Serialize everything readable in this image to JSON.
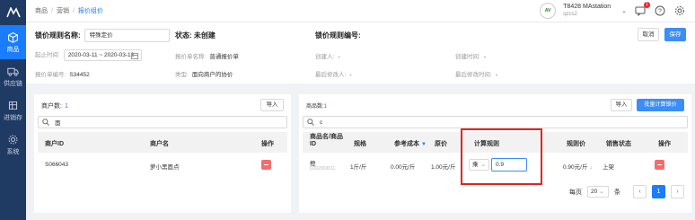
{
  "sidebar": {
    "items": [
      {
        "label": "商品",
        "icon": "box-icon",
        "active": true
      },
      {
        "label": "供应链",
        "icon": "truck-icon",
        "active": false
      },
      {
        "label": "进销存",
        "icon": "inventory-icon",
        "active": false
      },
      {
        "label": "系统",
        "icon": "gear-icon",
        "active": false
      }
    ]
  },
  "breadcrumb": [
    "商品",
    "营销",
    "报价组价"
  ],
  "topbar": {
    "store_logo": "AV",
    "store_name": "T8428 MAstation",
    "store_code": "qzcs2",
    "notification_count": "1"
  },
  "header": {
    "name_label": "锁价规则名称:",
    "name_value": "特殊定价",
    "status_label": "状态:",
    "status_value": "未创建",
    "code_label": "锁价规则编号:",
    "cancel_label": "取消",
    "save_label": "保存",
    "start_label": "起止时间",
    "date_range": "2020-03-11 ~ 2020-03-13",
    "quote_name_label": "报价单名称:",
    "quote_name_value": "普通报价单",
    "creator_label": "创建人:",
    "creator_value": "-",
    "created_time_label": "创建时间:",
    "created_time_value": "-",
    "quote_code_label": "报价单编号:",
    "quote_code_value": "S34452",
    "type_label": "类型:",
    "type_value": "面向商户的协价",
    "modifier_label": "最后修改人:",
    "modifier_value": "-",
    "modified_time_label": "最后修改时间:",
    "modified_time_value": "-"
  },
  "merchants": {
    "count_label": "商户数:",
    "count": "1",
    "import_label": "导入",
    "search_value": "面",
    "columns": [
      "商户ID",
      "商户名",
      "操作"
    ],
    "rows": [
      {
        "id": "S066043",
        "name": "萝小黑面点"
      }
    ]
  },
  "products": {
    "count_label": "商品数:",
    "count": "1",
    "import_label": "导入",
    "batch_label": "批量计算锁价",
    "search_value": "c",
    "columns": [
      "商品名/商品ID",
      "规格",
      "参考成本",
      "原价",
      "计算规则",
      "规则价",
      "销售状态",
      "操作"
    ],
    "rows": [
      {
        "name": "橙",
        "product_id": "D202003011",
        "spec": "1斤/斤",
        "ref_cost": "0.00元/斤",
        "orig_price": "1.00元/斤",
        "calc_op": "乘",
        "calc_value": "0.9",
        "rule_price": "0.90元/斤",
        "sale_status": "上架"
      }
    ],
    "pager": {
      "per_page_label": "每页",
      "page_size": "20",
      "unit_label": "条",
      "current_page": "1"
    }
  },
  "colors": {
    "sidebar_bg": "#1f3a63",
    "accent": "#1a7dff",
    "danger": "#f56c6c",
    "highlight_border": "#e0271f"
  }
}
